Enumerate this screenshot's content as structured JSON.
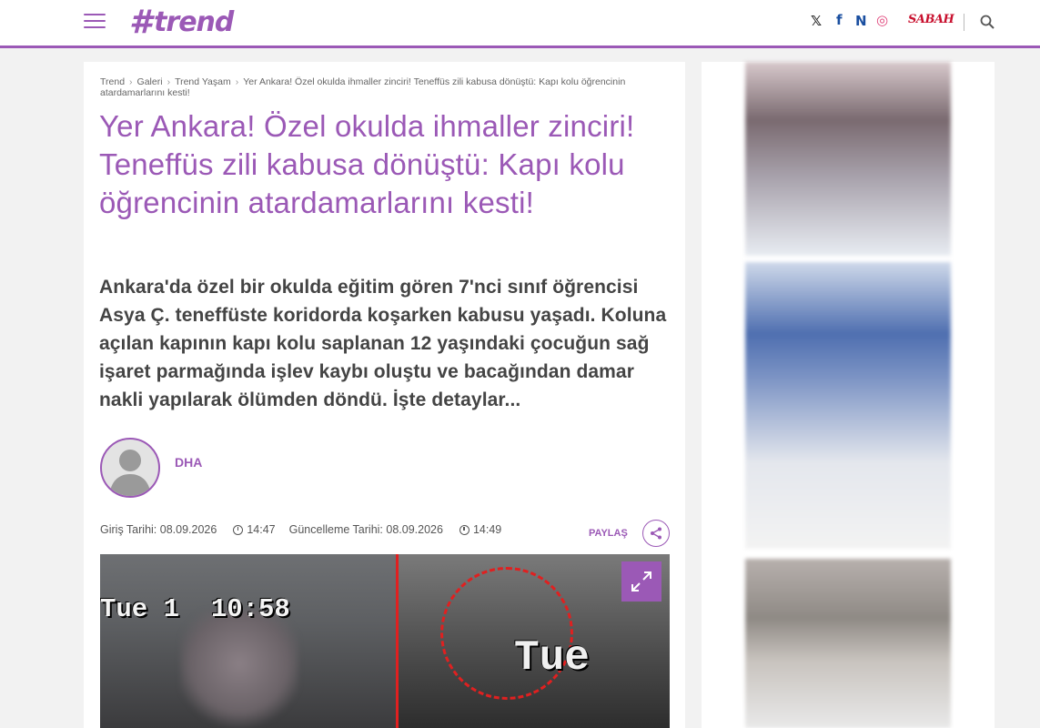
{
  "header": {
    "logo_hash": "#",
    "logo_text": "trend",
    "social": [
      {
        "name": "x",
        "glyph": "𝕏",
        "color": "#222222"
      },
      {
        "name": "facebook",
        "glyph": "f",
        "color": "#1a4fa0"
      },
      {
        "name": "n",
        "glyph": "N",
        "color": "#1a4fa0"
      },
      {
        "name": "instagram",
        "glyph": "◎",
        "color": "#e0457b"
      }
    ],
    "sabah": "SABAH"
  },
  "breadcrumb": [
    "Trend",
    "Galeri",
    "Trend Yaşam",
    "Yer Ankara! Özel okulda ihmaller zinciri! Teneffüs zili kabusa dönüştü: Kapı kolu öğrencinin atardamarlarını kesti!"
  ],
  "article": {
    "title": "Yer Ankara! Özel okulda ihmaller zinciri! Teneffüs zili kabusa dönüştü: Kapı kolu öğrencinin atardamarlarını kesti!",
    "summary": "Ankara'da özel bir okulda eğitim gören 7'nci sınıf öğrencisi Asya Ç. teneffüste koridorda koşarken kabusu yaşadı. Koluna açılan kapının kapı kolu saplanan 12 yaşındaki çocuğun sağ işaret parmağında işlev kaybı oluştu ve bacağından damar nakli yapılarak ölümden döndü. İşte detaylar...",
    "author": "DHA",
    "published_label": "Giriş Tarihi: 08.09.2026",
    "published_time": "14:47",
    "updated_label": "Güncelleme Tarihi: 08.09.2026",
    "updated_time": "14:49",
    "share_label": "PAYLAŞ"
  },
  "video": {
    "timestamp_left": "Tue 1  10:58",
    "timestamp_right": "Tue"
  },
  "colors": {
    "accent": "#9b59b6",
    "alert_red": "#e02020",
    "sabah_red": "#c8102e"
  }
}
